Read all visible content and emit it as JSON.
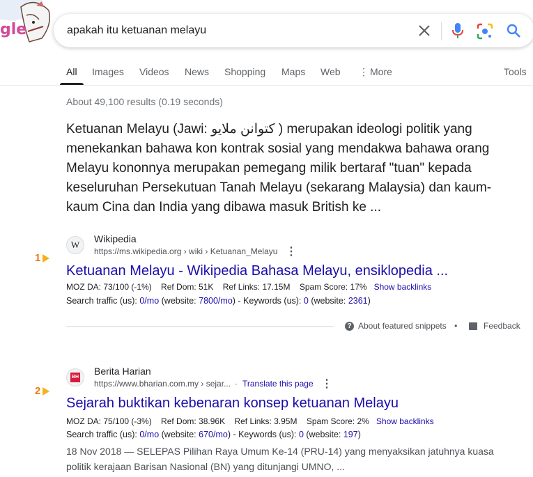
{
  "search": {
    "query": "apakah itu ketuanan melayu"
  },
  "logo": {
    "text_fragment": "gle"
  },
  "tabs": [
    {
      "label": "All"
    },
    {
      "label": "Images"
    },
    {
      "label": "Videos"
    },
    {
      "label": "News"
    },
    {
      "label": "Shopping"
    },
    {
      "label": "Maps"
    },
    {
      "label": "Web"
    },
    {
      "label": "More"
    }
  ],
  "tools_label": "Tools",
  "stats": "About 49,100 results (0.19 seconds)",
  "featured_snippet": {
    "text": "Ketuanan Melayu (Jawi: كتوانن ملايو ) merupakan ideologi politik yang menekankan bahawa kon kontrak sosial yang mendakwa bahawa orang Melayu kononnya merupakan pemegang milik bertaraf \"tuan\" kepada keseluruhan Persekutuan Tanah Melayu (sekarang Malaysia) dan kaum-kaum Cina dan India yang dibawa masuk British ke ...",
    "about_label": "About featured snippets",
    "bullet": "•",
    "feedback_label": "Feedback"
  },
  "results": [
    {
      "rank": "1",
      "favicon_text": "W",
      "site": "Wikipedia",
      "url": "https://ms.wikipedia.org › wiki › Ketuanan_Melayu",
      "title": "Ketuanan Melayu - Wikipedia Bahasa Melayu, ensiklopedia ...",
      "moz_da": "MOZ DA: 73/100 (-1%)",
      "ref_dom": "Ref Dom: 51K",
      "ref_links": "Ref Links: 17.15M",
      "spam": "Spam Score: 17%",
      "backlinks": "Show backlinks",
      "traffic_prefix": "Search traffic (us): ",
      "traffic_val": "0/mo",
      "website_prefix": " (website: ",
      "website_val": "7800/mo",
      "kw_prefix": ") - Keywords (us): ",
      "kw_val": "0",
      "kw_website_prefix": " (website: ",
      "kw_website_val": "2361",
      "suffix": ")"
    },
    {
      "rank": "2",
      "favicon_text": "BH",
      "site": "Berita Harian",
      "url": "https://www.bharian.com.my › sejar...",
      "translate": "Translate this page",
      "title": "Sejarah buktikan kebenaran konsep ketuanan Melayu",
      "moz_da": "MOZ DA: 75/100 (-3%)",
      "ref_dom": "Ref Dom: 38.96K",
      "ref_links": "Ref Links: 3.95M",
      "spam": "Spam Score: 2%",
      "backlinks": "Show backlinks",
      "traffic_prefix": "Search traffic (us): ",
      "traffic_val": "0/mo",
      "website_prefix": " (website: ",
      "website_val": "670/mo",
      "kw_prefix": ") - Keywords (us): ",
      "kw_val": "0",
      "kw_website_prefix": " (website: ",
      "kw_website_val": "197",
      "suffix": ")",
      "description": "18 Nov 2018 — SELEPAS Pilihan Raya Umum Ke-14 (PRU-14) yang menyaksikan jatuhnya kuasa politik kerajaan Barisan Nasional (BN) yang ditunjangi UMNO, ..."
    }
  ],
  "colors": {
    "link": "#1a0dab",
    "rank": "#f07b00",
    "rank_arrow": "#f5b020"
  }
}
